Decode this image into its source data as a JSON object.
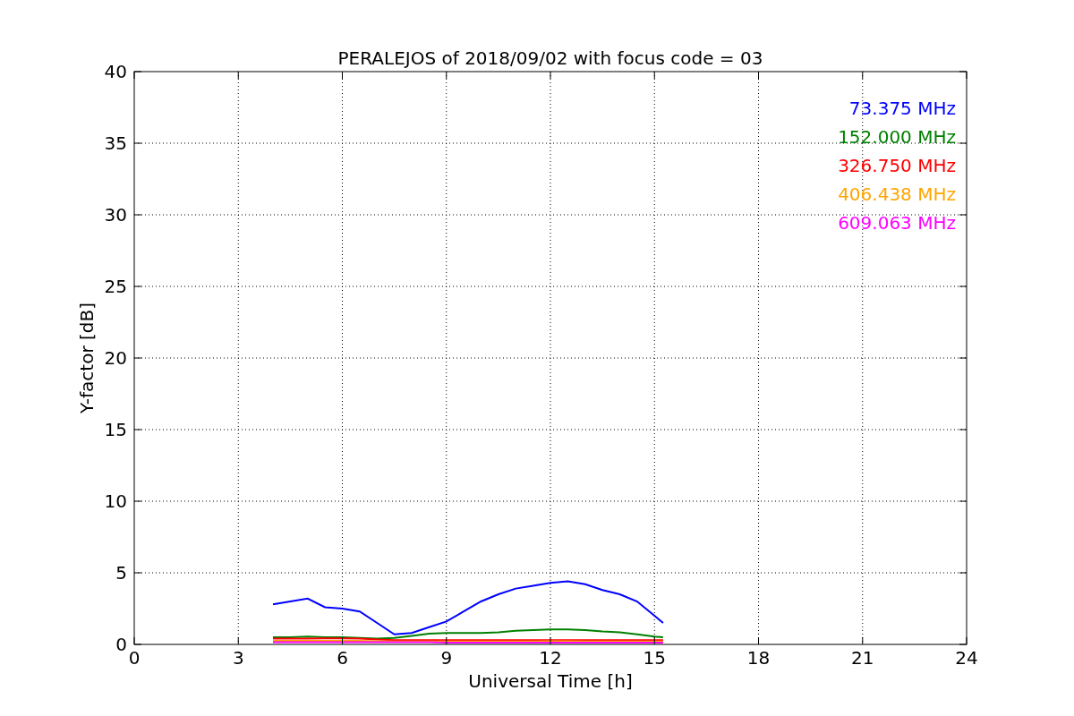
{
  "chart_data": {
    "type": "line",
    "title": "PERALEJOS of 2018/09/02 with focus code = 03",
    "xlabel": "Universal Time [h]",
    "ylabel": "Y-factor [dB]",
    "x": [
      4,
      4.5,
      5,
      5.5,
      6,
      6.5,
      7,
      7.5,
      8,
      8.5,
      9,
      9.5,
      10,
      10.5,
      11,
      11.5,
      12,
      12.5,
      13,
      13.5,
      14,
      14.5,
      15,
      15.25
    ],
    "series": [
      {
        "name": "73.375 MHz",
        "color": "#0000ff",
        "values": [
          2.8,
          3.0,
          3.2,
          2.6,
          2.5,
          2.3,
          1.5,
          0.7,
          0.8,
          1.2,
          1.6,
          2.3,
          3.0,
          3.5,
          3.9,
          4.1,
          4.3,
          4.4,
          4.2,
          3.8,
          3.5,
          3.0,
          2.0,
          1.5
        ]
      },
      {
        "name": "152.000 MHz",
        "color": "#008000",
        "values": [
          0.5,
          0.5,
          0.55,
          0.5,
          0.5,
          0.45,
          0.4,
          0.45,
          0.6,
          0.75,
          0.8,
          0.8,
          0.8,
          0.85,
          0.95,
          1.0,
          1.05,
          1.05,
          1.0,
          0.9,
          0.85,
          0.7,
          0.55,
          0.5
        ]
      },
      {
        "name": "326.750 MHz",
        "color": "#ff0000",
        "values": [
          0.4,
          0.4,
          0.4,
          0.42,
          0.42,
          0.4,
          0.35,
          0.3,
          0.3,
          0.3,
          0.3,
          0.3,
          0.3,
          0.3,
          0.3,
          0.3,
          0.3,
          0.3,
          0.3,
          0.3,
          0.3,
          0.3,
          0.3,
          0.3
        ]
      },
      {
        "name": "406.438 MHz",
        "color": "#ffa500",
        "values": [
          0.25,
          0.25,
          0.25,
          0.25,
          0.25,
          0.25,
          0.22,
          0.2,
          0.2,
          0.2,
          0.2,
          0.2,
          0.2,
          0.2,
          0.2,
          0.2,
          0.22,
          0.22,
          0.2,
          0.2,
          0.2,
          0.2,
          0.2,
          0.2
        ]
      },
      {
        "name": "609.063 MHz",
        "color": "#ff00ff",
        "values": [
          0.15,
          0.15,
          0.15,
          0.15,
          0.15,
          0.15,
          0.15,
          0.15,
          0.15,
          0.15,
          0.12,
          0.12,
          0.12,
          0.12,
          0.12,
          0.12,
          0.12,
          0.12,
          0.12,
          0.12,
          0.12,
          0.12,
          0.12,
          0.12
        ]
      }
    ],
    "xlim": [
      0,
      24
    ],
    "ylim": [
      0,
      40
    ],
    "xticks": [
      0,
      3,
      6,
      9,
      12,
      15,
      18,
      21,
      24
    ],
    "yticks": [
      0,
      5,
      10,
      15,
      20,
      25,
      30,
      35,
      40
    ],
    "grid": true
  }
}
